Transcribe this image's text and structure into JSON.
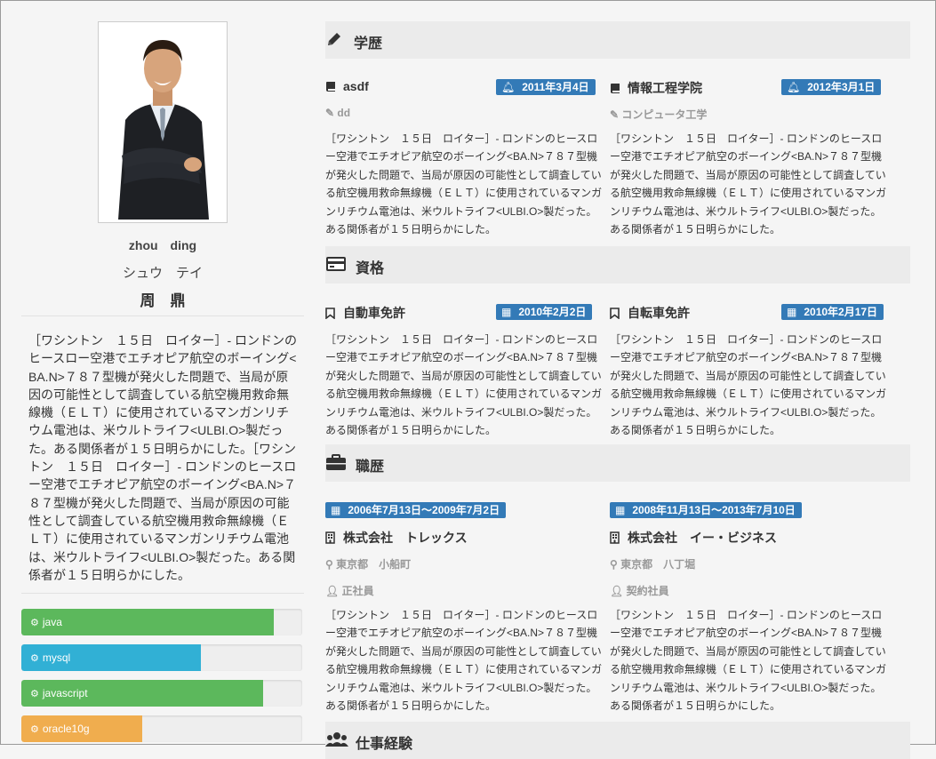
{
  "profile": {
    "name_roman": "zhou　ding",
    "name_kana": "シュウ　テイ",
    "name_kanji": "周　鼎",
    "bio": "［ワシントン　１５日　ロイター］- ロンドンのヒースロー空港でエチオピア航空のボーイング<BA.N>７８７型機が発火した問題で、当局が原因の可能性として調査している航空機用救命無線機（ＥＬＴ）に使用されているマンガンリチウム電池は、米ウルトライフ<ULBI.O>製だった。ある関係者が１５日明らかにした。［ワシントン　１５日　ロイター］- ロンドンのヒースロー空港でエチオピア航空のボーイング<BA.N>７８７型機が発火した問題で、当局が原因の可能性として調査している航空機用救命無線機（ＥＬＴ）に使用されているマンガンリチウム電池は、米ウルトライフ<ULBI.O>製だった。ある関係者が１５日明らかにした。"
  },
  "skills": [
    {
      "name": "java",
      "level": 0.9,
      "color": "#5cb85c"
    },
    {
      "name": "mysql",
      "level": 0.64,
      "color": "#31b0d5"
    },
    {
      "name": "javascript",
      "level": 0.86,
      "color": "#5cb85c"
    },
    {
      "name": "oracle10g",
      "level": 0.43,
      "color": "#f0ad4e"
    }
  ],
  "sections": {
    "education": {
      "title": "学歴",
      "items": [
        {
          "school": "asdf",
          "date": "2011年3月4日",
          "major": "dd",
          "desc": "［ワシントン　１５日　ロイター］- ロンドンのヒースロー空港でエチオピア航空のボーイング<BA.N>７８７型機が発火した問題で、当局が原因の可能性として調査している航空機用救命無線機（ＥＬＴ）に使用されているマンガンリチウム電池は、米ウルトライフ<ULBI.O>製だった。ある関係者が１５日明らかにした。"
        },
        {
          "school": "情報工程学院",
          "date": "2012年3月1日",
          "major": "コンピュータ工学",
          "desc": "［ワシントン　１５日　ロイター］- ロンドンのヒースロー空港でエチオピア航空のボーイング<BA.N>７８７型機が発火した問題で、当局が原因の可能性として調査している航空機用救命無線機（ＥＬＴ）に使用されているマンガンリチウム電池は、米ウルトライフ<ULBI.O>製だった。ある関係者が１５日明らかにした。"
        }
      ]
    },
    "certificates": {
      "title": "資格",
      "items": [
        {
          "name": "自動車免許",
          "date": "2010年2月2日",
          "desc": "［ワシントン　１５日　ロイター］- ロンドンのヒースロー空港でエチオピア航空のボーイング<BA.N>７８７型機が発火した問題で、当局が原因の可能性として調査している航空機用救命無線機（ＥＬＴ）に使用されているマンガンリチウム電池は、米ウルトライフ<ULBI.O>製だった。ある関係者が１５日明らかにした。"
        },
        {
          "name": "自転車免許",
          "date": "2010年2月17日",
          "desc": "［ワシントン　１５日　ロイター］- ロンドンのヒースロー空港でエチオピア航空のボーイング<BA.N>７８７型機が発火した問題で、当局が原因の可能性として調査している航空機用救命無線機（ＥＬＴ）に使用されているマンガンリチウム電池は、米ウルトライフ<ULBI.O>製だった。ある関係者が１５日明らかにした。"
        }
      ]
    },
    "career": {
      "title": "職歴",
      "items": [
        {
          "period": "2006年7月13日～2009年7月2日",
          "company": "株式会社　トレックス",
          "location": "東京都　小船町",
          "employment": "正社員",
          "desc": "［ワシントン　１５日　ロイター］- ロンドンのヒースロー空港でエチオピア航空のボーイング<BA.N>７８７型機が発火した問題で、当局が原因の可能性として調査している航空機用救命無線機（ＥＬＴ）に使用されているマンガンリチウム電池は、米ウルトライフ<ULBI.O>製だった。ある関係者が１５日明らかにした。"
        },
        {
          "period": "2008年11月13日～2013年7月10日",
          "company": "株式会社　イー・ビジネス",
          "location": "東京都　八丁堀",
          "employment": "契約社員",
          "desc": "［ワシントン　１５日　ロイター］- ロンドンのヒースロー空港でエチオピア航空のボーイング<BA.N>７８７型機が発火した問題で、当局が原因の可能性として調査している航空機用救命無線機（ＥＬＴ）に使用されているマンガンリチウム電池は、米ウルトライフ<ULBI.O>製だった。ある関係者が１５日明らかにした。"
        }
      ]
    },
    "work_experience": {
      "title": "仕事経験"
    }
  },
  "icons": {
    "education_header": "pencil-icon",
    "certificates_header": "id-card-icon",
    "career_header": "briefcase-icon",
    "work_experience_header": "users-icon",
    "school": "book-icon",
    "date": "bell-icon",
    "major": "pencil-icon",
    "certificate": "bookmark-icon",
    "calendar": "calendar-icon",
    "company": "building-icon",
    "location": "map-marker-icon",
    "employment": "user-icon",
    "skill": "gear-icon"
  }
}
